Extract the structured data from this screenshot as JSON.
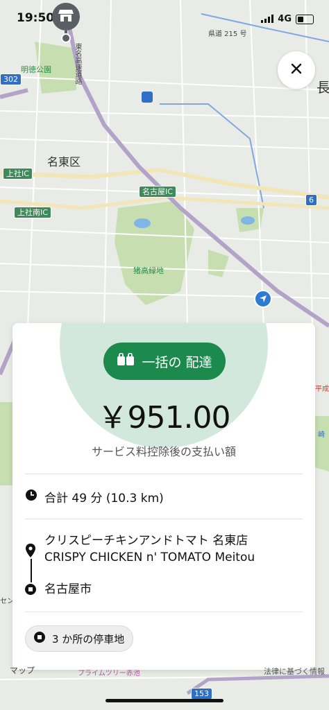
{
  "status_bar": {
    "time": "19:50",
    "network": "4G"
  },
  "map": {
    "labels": {
      "district": "名東区",
      "park_meitoku": "明徳公園",
      "park_inotaka": "猪高緑地",
      "ic_kamiyashiro": "上社IC",
      "ic_kamiyashiro_minami": "上社南IC",
      "ic_nagoya": "名古屋IC",
      "route_6": "6",
      "route_302": "302",
      "route_153": "153",
      "prefectural_215": "県道 215 号",
      "expressway": "東名高速道路",
      "edge_char": "長",
      "edge_senior": "セン",
      "edge_heisei": "平成",
      "edge_sasaki": "崎",
      "bottom_store": "プライムツリー赤池"
    },
    "colors": {
      "road_major": "#b3a3c8",
      "park": "#c6deb0",
      "water": "#7fb6e6",
      "route_blue": "#2f6fc6"
    }
  },
  "apple_maps": "マップ",
  "legal": "法律に基づく情報",
  "offer": {
    "type_label": "一括の 配達",
    "fare": "￥951.00",
    "fare_subtitle": "サービス料控除後の支払い額",
    "trip_summary": "合計 49 分 (10.3 km)",
    "pickup_name_jp": "クリスピーチキンアンドトマト 名東店",
    "pickup_name_en": "CRISPY CHICKEN n' TOMATO Meitou",
    "dropoff": "名古屋市",
    "stops": "3 か所の停車地",
    "accent_color": "#1c8a4c"
  },
  "icons": {
    "location_arrow": "location-arrow-icon",
    "close": "close-icon",
    "clock": "clock-icon",
    "pickup_pin": "pin-icon",
    "dropoff_square": "square-stop-icon",
    "batch": "bag-icon"
  }
}
